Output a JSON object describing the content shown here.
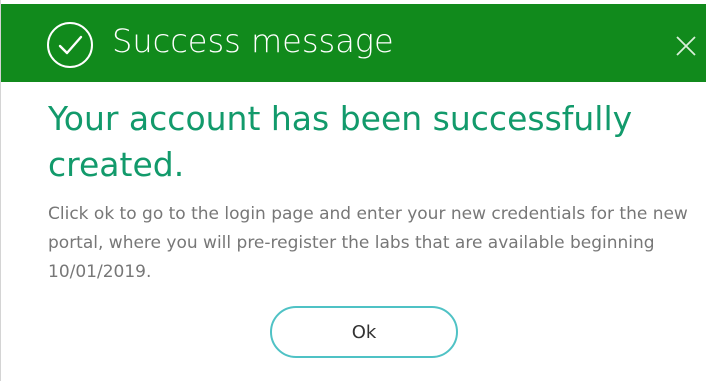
{
  "header": {
    "title": "Success message",
    "icon": "check-circle-icon",
    "close_icon": "close-icon",
    "background_color": "#118a1c"
  },
  "body": {
    "heading": "Your account has been successfully created.",
    "message": "Click ok to go to the login page and enter your new credentials for the new portal, where you will pre-register the labs that are available beginning 10/01/2019.",
    "heading_color": "#129a6b"
  },
  "actions": {
    "ok_label": "Ok",
    "ok_border_color": "#4fc2c5"
  }
}
